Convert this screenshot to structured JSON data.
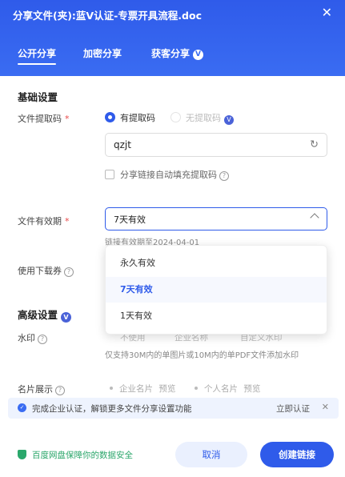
{
  "dialog": {
    "title": "分享文件(夹):蓝V认证-专票开具流程.doc",
    "close_glyph": "✕"
  },
  "tabs": [
    {
      "label": "公开分享",
      "active": true
    },
    {
      "label": "加密分享",
      "active": false
    },
    {
      "label": "获客分享",
      "active": false,
      "badge": "V"
    }
  ],
  "basic": {
    "section_title": "基础设置",
    "extract_code": {
      "label": "文件提取码",
      "required": "*",
      "option_with": "有提取码",
      "option_without": "无提取码",
      "vip_badge": "V",
      "value": "qzjt",
      "refresh_icon": "↻",
      "autofill_label": "分享链接自动填充提取码"
    },
    "validity": {
      "label": "文件有效期",
      "required": "*",
      "selected": "7天有效",
      "hint": "链接有效期至2024-04-01",
      "options": [
        "永久有效",
        "7天有效",
        "1天有效"
      ]
    },
    "download_coupon": {
      "label": "使用下载券"
    }
  },
  "advanced": {
    "section_title": "高级设置",
    "vip_badge": "V",
    "watermark": {
      "label": "水印",
      "options": [
        "不使用",
        "企业名称",
        "自定义水印"
      ],
      "hint": "仅支持30M内的单图片或10M内的单PDF文件添加水印"
    },
    "card": {
      "label": "名片展示",
      "options": [
        {
          "name": "企业名片",
          "preview": "预览"
        },
        {
          "name": "个人名片",
          "preview": "预览"
        }
      ]
    }
  },
  "banner": {
    "text": "完成企业认证，解锁更多文件分享设置功能",
    "link": "立即认证",
    "close_glyph": "✕"
  },
  "footer": {
    "security_note": "百度网盘保障你的数据安全",
    "cancel_label": "取消",
    "create_label": "创建链接"
  },
  "colors": {
    "primary": "#2f5bea",
    "success": "#2aa66a",
    "required": "#e84848"
  }
}
